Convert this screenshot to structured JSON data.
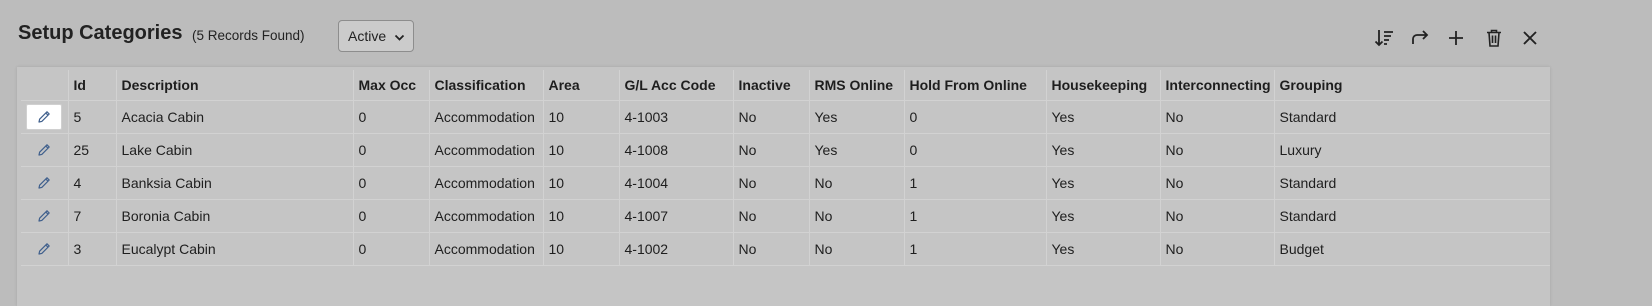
{
  "header": {
    "title": "Setup Categories",
    "record_count": "(5 Records Found)",
    "status_filter": "Active"
  },
  "toolbar": {
    "icons": [
      "sort-icon",
      "share-icon",
      "add-icon",
      "delete-icon",
      "close-icon"
    ]
  },
  "table": {
    "columns": [
      "",
      "Id",
      "Description",
      "Max Occ",
      "Classification",
      "Area",
      "G/L Acc Code",
      "Inactive",
      "RMS Online",
      "Hold From Online",
      "Housekeeping",
      "Interconnecting",
      "Grouping"
    ],
    "rows": [
      [
        "5",
        "Acacia Cabin",
        "0",
        "Accommodation",
        "10",
        "4-1003",
        "No",
        "Yes",
        "0",
        "Yes",
        "No",
        "Standard"
      ],
      [
        "25",
        "Lake Cabin",
        "0",
        "Accommodation",
        "10",
        "4-1008",
        "No",
        "Yes",
        "0",
        "Yes",
        "No",
        "Luxury"
      ],
      [
        "4",
        "Banksia Cabin",
        "0",
        "Accommodation",
        "10",
        "4-1004",
        "No",
        "No",
        "1",
        "Yes",
        "No",
        "Standard"
      ],
      [
        "7",
        "Boronia Cabin",
        "0",
        "Accommodation",
        "10",
        "4-1007",
        "No",
        "No",
        "1",
        "Yes",
        "No",
        "Standard"
      ],
      [
        "3",
        "Eucalypt Cabin",
        "0",
        "Accommodation",
        "10",
        "4-1002",
        "No",
        "No",
        "1",
        "Yes",
        "No",
        "Budget"
      ]
    ]
  },
  "colors": {
    "page_bg": "#bcbcbc",
    "panel_bg": "#c5c5c5",
    "edit_icon": "#3f5f8c"
  }
}
